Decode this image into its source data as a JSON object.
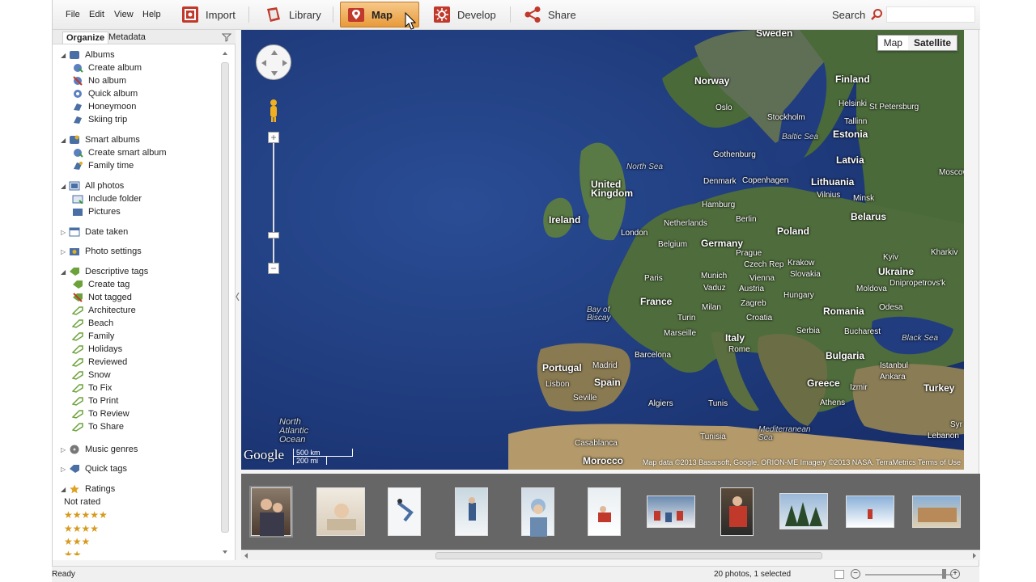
{
  "menu": {
    "file": "File",
    "edit": "Edit",
    "view": "View",
    "help": "Help"
  },
  "modes": {
    "import": "Import",
    "library": "Library",
    "map": "Map",
    "develop": "Develop",
    "share": "Share"
  },
  "search": {
    "label": "Search",
    "placeholder": ""
  },
  "panel": {
    "tab_organize": "Organize",
    "tab_metadata": "Metadata"
  },
  "tree": {
    "albums": "Albums",
    "albums_items": [
      "Create album",
      "No album",
      "Quick album",
      "Honeymoon",
      "Skiing trip"
    ],
    "smart_albums": "Smart albums",
    "smart_items": [
      "Create smart album",
      "Family time"
    ],
    "all_photos": "All photos",
    "all_items": [
      "Include folder",
      "Pictures"
    ],
    "date_taken": "Date taken",
    "photo_settings": "Photo settings",
    "descriptive_tags": "Descriptive tags",
    "tag_items": [
      "Create tag",
      "Not tagged",
      "Architecture",
      "Beach",
      "Family",
      "Holidays",
      "Reviewed",
      "Snow",
      "To Fix",
      "To Print",
      "To Review",
      "To Share"
    ],
    "music_genres": "Music genres",
    "quick_tags": "Quick tags",
    "ratings": "Ratings",
    "not_rated": "Not rated",
    "stars": [
      "★★★★★",
      "★★★★",
      "★★★",
      "★★"
    ]
  },
  "map": {
    "toggle_map": "Map",
    "toggle_satellite": "Satellite",
    "labels": {
      "sweden": "Sweden",
      "norway": "Norway",
      "finland": "Finland",
      "oslo": "Oslo",
      "helsinki": "Helsinki",
      "st_petersburg": "St Petersburg",
      "stockholm": "Stockholm",
      "tallinn": "Tallinn",
      "baltic_sea": "Baltic Sea",
      "estonia": "Estonia",
      "gothenburg": "Gothenburg",
      "latvia": "Latvia",
      "denmark": "Denmark",
      "copenhagen": "Copenhagen",
      "lithuania": "Lithuania",
      "vilnius": "Vilnius",
      "minsk": "Minsk",
      "moscow": "Moscow",
      "north_sea": "North Sea",
      "united_kingdom": "United\nKingdom",
      "ireland": "Ireland",
      "hamburg": "Hamburg",
      "belarus": "Belarus",
      "netherlands": "Netherlands",
      "berlin": "Berlin",
      "london": "London",
      "poland": "Poland",
      "belgium": "Belgium",
      "germany": "Germany",
      "kyiv": "Kyiv",
      "kharkiv": "Kharkiv",
      "prague": "Prague",
      "czech_rep": "Czech Rep",
      "krakow": "Krakow",
      "paris": "Paris",
      "slovakia": "Slovakia",
      "ukraine": "Ukraine",
      "munich": "Munich",
      "vaduz": "Vaduz",
      "vienna": "Vienna",
      "dnipropetrovsk": "Dnipropetrovs'k",
      "moldova": "Moldova",
      "austria": "Austria",
      "france": "France",
      "hungary": "Hungary",
      "bay_of_biscay": "Bay of\nBiscay",
      "milan": "Milan",
      "zagreb": "Zagreb",
      "romania": "Romania",
      "odesa": "Odesa",
      "turin": "Turin",
      "croatia": "Croatia",
      "marseille": "Marseille",
      "serbia": "Serbia",
      "bucharest": "Bucharest",
      "black_sea": "Black Sea",
      "italy": "Italy",
      "rome": "Rome",
      "bulgaria": "Bulgaria",
      "barcelona": "Barcelona",
      "istanbul": "Istanbul",
      "portugal": "Portugal",
      "madrid": "Madrid",
      "spain": "Spain",
      "ankara": "Ankara",
      "lisbon": "Lisbon",
      "greece": "Greece",
      "izmir": "Izmir",
      "turkey": "Turkey",
      "seville": "Seville",
      "athens": "Athens",
      "algiers": "Algiers",
      "tunis": "Tunis",
      "north_atlantic": "North\nAtlantic\nOcean",
      "mediterranean": "Mediterranean\nSea",
      "tunisia": "Tunisia",
      "syria": "Syr",
      "lebanon": "Lebanon",
      "casablanca": "Casablanca",
      "morocco": "Morocco"
    },
    "google": "Google",
    "scale_km": "500 km",
    "scale_mi": "200 mi",
    "attribution": "Map data ©2013 Basarsoft, Google, ORION-ME Imagery ©2013 NASA, TerraMetrics  Terms of Use"
  },
  "status": {
    "ready": "Ready",
    "count": "20 photos, 1 selected"
  }
}
